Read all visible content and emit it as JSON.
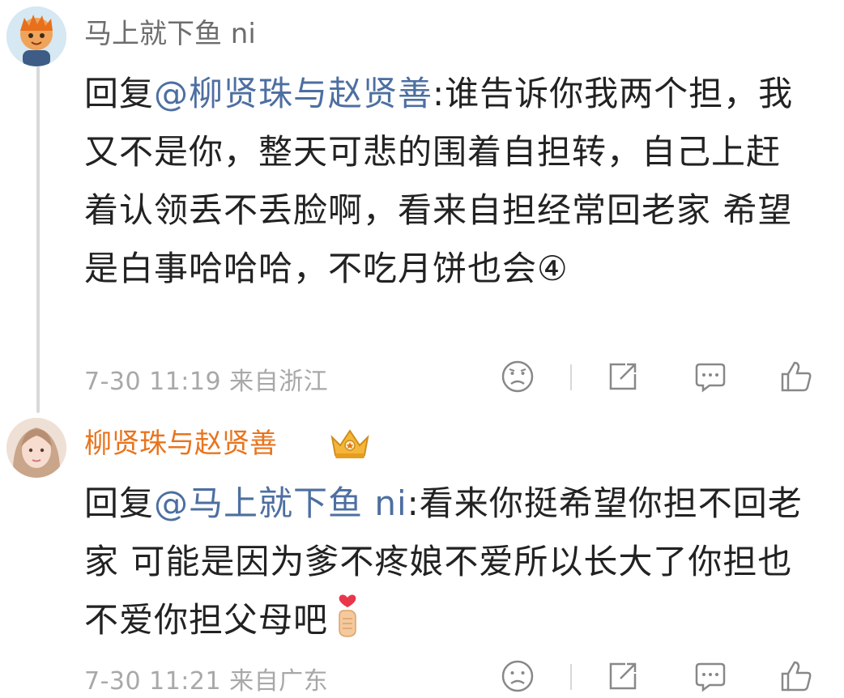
{
  "comments": [
    {
      "username": "马上就下鱼 ni",
      "reply_prefix": "回复",
      "mention": "@柳贤珠与赵贤善",
      "text": ":谁告诉你我两个担，我又不是你，整天可悲的围着自担转，自己上赶着认领丢不丢脸啊，看来自担经常回老家 希望是白事哈哈哈，不吃月饼也会④",
      "timestamp": "7-30 11:19",
      "location": "来自浙江"
    },
    {
      "username": "柳贤珠与赵贤善",
      "reply_prefix": "回复",
      "mention": "@马上就下鱼 ni",
      "text": ":看来你挺希望你担不回老家 可能是因为爹不疼娘不爱所以长大了你担也不爱你担父母吧",
      "timestamp": "7-30 11:21",
      "location": "来自广东"
    }
  ],
  "icons": {
    "emoji": "sad-face-icon",
    "share": "share-icon",
    "comment": "comment-icon",
    "like": "thumbs-up-icon",
    "badge": "crown-badge-icon",
    "finger_heart": "finger-heart-emoji"
  },
  "colors": {
    "username_gray": "#6d6d6d",
    "username_orange": "#e8741e",
    "mention_blue": "#4d6fa1",
    "text": "#222222",
    "meta": "#a8a8a8"
  }
}
